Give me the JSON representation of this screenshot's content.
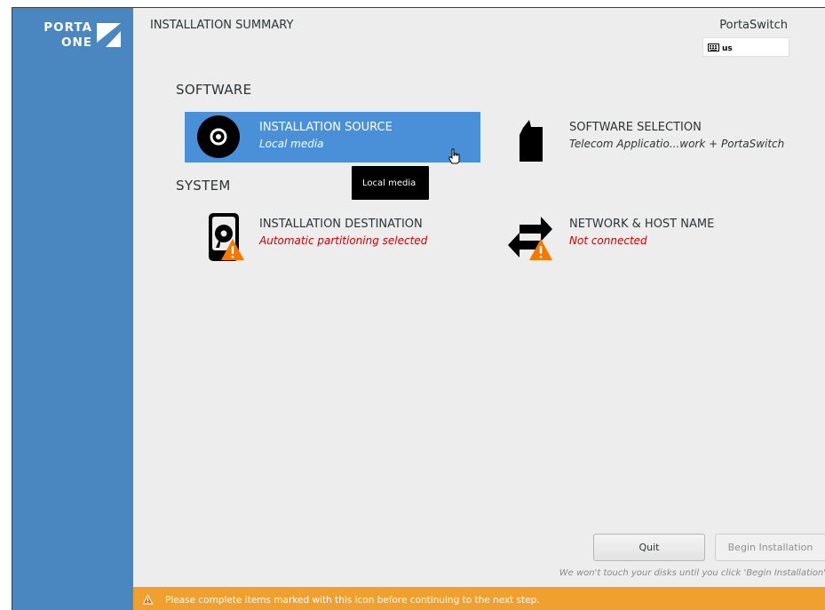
{
  "header": {
    "title": "INSTALLATION SUMMARY",
    "product": "PortaSwitch",
    "keyboard_layout": "us"
  },
  "logo": {
    "line1": "PORTA",
    "line2": "ONE"
  },
  "sections": {
    "software": "SOFTWARE",
    "system": "SYSTEM"
  },
  "spokes": {
    "installation_source": {
      "title": "INSTALLATION SOURCE",
      "status": "Local media",
      "icon": "disc-icon"
    },
    "software_selection": {
      "title": "SOFTWARE SELECTION",
      "status": "Telecom Applicatio...work + PortaSwitch",
      "icon": "package-icon"
    },
    "installation_destination": {
      "title": "INSTALLATION DESTINATION",
      "status": "Automatic partitioning selected",
      "icon": "hard-drive-warning-icon"
    },
    "network_host": {
      "title": "NETWORK & HOST NAME",
      "status": "Not connected",
      "icon": "network-warning-icon"
    }
  },
  "tooltip": "Local media",
  "buttons": {
    "quit": "Quit",
    "begin": "Begin Installation"
  },
  "disk_notice": "We won't touch your disks until you click 'Begin Installation'",
  "warning_bar": "Please complete items marked with this icon before continuing to the next step.",
  "colors": {
    "sidebar": "#4a86c0",
    "selected_spoke": "#4a90d9",
    "warning": "#f0a030",
    "error_text": "#cc0000"
  }
}
